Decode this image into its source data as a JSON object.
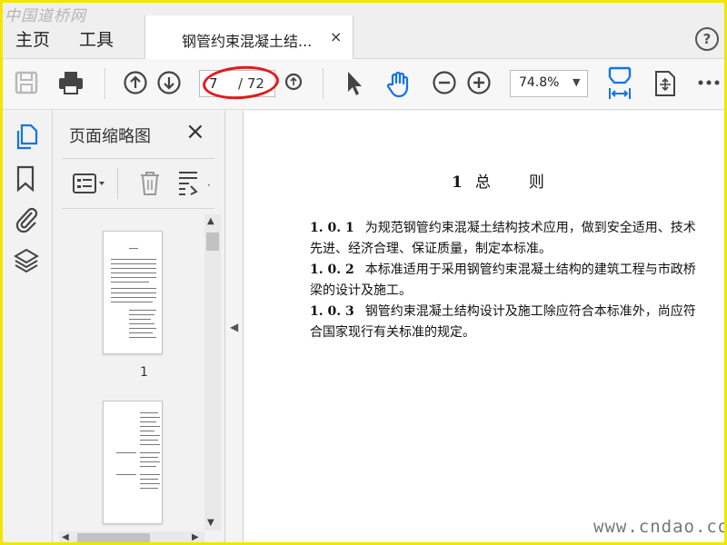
{
  "watermark_top": "中国道桥网",
  "watermark_bottom": "www.cndao.com",
  "menu": {
    "home": "主页",
    "tools": "工具"
  },
  "tab": {
    "title": "钢管约束混凝土结...",
    "close": "×"
  },
  "help": "?",
  "toolbar": {
    "page_current": "7",
    "page_total": "/ 72",
    "zoom": "74.8%"
  },
  "thumbnail_panel": {
    "title": "页面缩略图",
    "close": "×",
    "pages": [
      {
        "number": "1"
      }
    ]
  },
  "document": {
    "heading_number": "1",
    "heading_char1": "总",
    "heading_char2": "则",
    "clauses": [
      {
        "number": "1. 0. 1",
        "text": "为规范钢管约束混凝土结构技术应用，做到安全适用、技术先进、经济合理、保证质量，制定本标准。"
      },
      {
        "number": "1. 0. 2",
        "text": "本标准适用于采用钢管约束混凝土结构的建筑工程与市政桥梁的设计及施工。"
      },
      {
        "number": "1. 0. 3",
        "text": "钢管约束混凝土结构设计及施工除应符合本标准外，尚应符合国家现行有关标准的规定。"
      }
    ]
  },
  "colors": {
    "frame": "#f2e600",
    "highlight_oval": "#e01b1b",
    "accent_blue": "#1473e6"
  }
}
